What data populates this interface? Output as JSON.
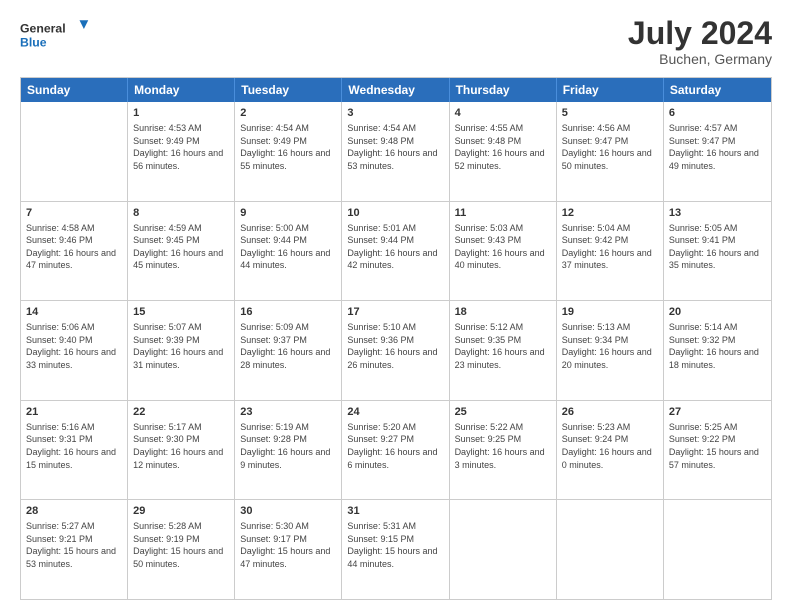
{
  "logo": {
    "line1": "General",
    "line2": "Blue"
  },
  "title": "July 2024",
  "subtitle": "Buchen, Germany",
  "header_days": [
    "Sunday",
    "Monday",
    "Tuesday",
    "Wednesday",
    "Thursday",
    "Friday",
    "Saturday"
  ],
  "rows": [
    [
      {
        "day": "",
        "sunrise": "",
        "sunset": "",
        "daylight": ""
      },
      {
        "day": "1",
        "sunrise": "Sunrise: 4:53 AM",
        "sunset": "Sunset: 9:49 PM",
        "daylight": "Daylight: 16 hours and 56 minutes."
      },
      {
        "day": "2",
        "sunrise": "Sunrise: 4:54 AM",
        "sunset": "Sunset: 9:49 PM",
        "daylight": "Daylight: 16 hours and 55 minutes."
      },
      {
        "day": "3",
        "sunrise": "Sunrise: 4:54 AM",
        "sunset": "Sunset: 9:48 PM",
        "daylight": "Daylight: 16 hours and 53 minutes."
      },
      {
        "day": "4",
        "sunrise": "Sunrise: 4:55 AM",
        "sunset": "Sunset: 9:48 PM",
        "daylight": "Daylight: 16 hours and 52 minutes."
      },
      {
        "day": "5",
        "sunrise": "Sunrise: 4:56 AM",
        "sunset": "Sunset: 9:47 PM",
        "daylight": "Daylight: 16 hours and 50 minutes."
      },
      {
        "day": "6",
        "sunrise": "Sunrise: 4:57 AM",
        "sunset": "Sunset: 9:47 PM",
        "daylight": "Daylight: 16 hours and 49 minutes."
      }
    ],
    [
      {
        "day": "7",
        "sunrise": "Sunrise: 4:58 AM",
        "sunset": "Sunset: 9:46 PM",
        "daylight": "Daylight: 16 hours and 47 minutes."
      },
      {
        "day": "8",
        "sunrise": "Sunrise: 4:59 AM",
        "sunset": "Sunset: 9:45 PM",
        "daylight": "Daylight: 16 hours and 45 minutes."
      },
      {
        "day": "9",
        "sunrise": "Sunrise: 5:00 AM",
        "sunset": "Sunset: 9:44 PM",
        "daylight": "Daylight: 16 hours and 44 minutes."
      },
      {
        "day": "10",
        "sunrise": "Sunrise: 5:01 AM",
        "sunset": "Sunset: 9:44 PM",
        "daylight": "Daylight: 16 hours and 42 minutes."
      },
      {
        "day": "11",
        "sunrise": "Sunrise: 5:03 AM",
        "sunset": "Sunset: 9:43 PM",
        "daylight": "Daylight: 16 hours and 40 minutes."
      },
      {
        "day": "12",
        "sunrise": "Sunrise: 5:04 AM",
        "sunset": "Sunset: 9:42 PM",
        "daylight": "Daylight: 16 hours and 37 minutes."
      },
      {
        "day": "13",
        "sunrise": "Sunrise: 5:05 AM",
        "sunset": "Sunset: 9:41 PM",
        "daylight": "Daylight: 16 hours and 35 minutes."
      }
    ],
    [
      {
        "day": "14",
        "sunrise": "Sunrise: 5:06 AM",
        "sunset": "Sunset: 9:40 PM",
        "daylight": "Daylight: 16 hours and 33 minutes."
      },
      {
        "day": "15",
        "sunrise": "Sunrise: 5:07 AM",
        "sunset": "Sunset: 9:39 PM",
        "daylight": "Daylight: 16 hours and 31 minutes."
      },
      {
        "day": "16",
        "sunrise": "Sunrise: 5:09 AM",
        "sunset": "Sunset: 9:37 PM",
        "daylight": "Daylight: 16 hours and 28 minutes."
      },
      {
        "day": "17",
        "sunrise": "Sunrise: 5:10 AM",
        "sunset": "Sunset: 9:36 PM",
        "daylight": "Daylight: 16 hours and 26 minutes."
      },
      {
        "day": "18",
        "sunrise": "Sunrise: 5:12 AM",
        "sunset": "Sunset: 9:35 PM",
        "daylight": "Daylight: 16 hours and 23 minutes."
      },
      {
        "day": "19",
        "sunrise": "Sunrise: 5:13 AM",
        "sunset": "Sunset: 9:34 PM",
        "daylight": "Daylight: 16 hours and 20 minutes."
      },
      {
        "day": "20",
        "sunrise": "Sunrise: 5:14 AM",
        "sunset": "Sunset: 9:32 PM",
        "daylight": "Daylight: 16 hours and 18 minutes."
      }
    ],
    [
      {
        "day": "21",
        "sunrise": "Sunrise: 5:16 AM",
        "sunset": "Sunset: 9:31 PM",
        "daylight": "Daylight: 16 hours and 15 minutes."
      },
      {
        "day": "22",
        "sunrise": "Sunrise: 5:17 AM",
        "sunset": "Sunset: 9:30 PM",
        "daylight": "Daylight: 16 hours and 12 minutes."
      },
      {
        "day": "23",
        "sunrise": "Sunrise: 5:19 AM",
        "sunset": "Sunset: 9:28 PM",
        "daylight": "Daylight: 16 hours and 9 minutes."
      },
      {
        "day": "24",
        "sunrise": "Sunrise: 5:20 AM",
        "sunset": "Sunset: 9:27 PM",
        "daylight": "Daylight: 16 hours and 6 minutes."
      },
      {
        "day": "25",
        "sunrise": "Sunrise: 5:22 AM",
        "sunset": "Sunset: 9:25 PM",
        "daylight": "Daylight: 16 hours and 3 minutes."
      },
      {
        "day": "26",
        "sunrise": "Sunrise: 5:23 AM",
        "sunset": "Sunset: 9:24 PM",
        "daylight": "Daylight: 16 hours and 0 minutes."
      },
      {
        "day": "27",
        "sunrise": "Sunrise: 5:25 AM",
        "sunset": "Sunset: 9:22 PM",
        "daylight": "Daylight: 15 hours and 57 minutes."
      }
    ],
    [
      {
        "day": "28",
        "sunrise": "Sunrise: 5:27 AM",
        "sunset": "Sunset: 9:21 PM",
        "daylight": "Daylight: 15 hours and 53 minutes."
      },
      {
        "day": "29",
        "sunrise": "Sunrise: 5:28 AM",
        "sunset": "Sunset: 9:19 PM",
        "daylight": "Daylight: 15 hours and 50 minutes."
      },
      {
        "day": "30",
        "sunrise": "Sunrise: 5:30 AM",
        "sunset": "Sunset: 9:17 PM",
        "daylight": "Daylight: 15 hours and 47 minutes."
      },
      {
        "day": "31",
        "sunrise": "Sunrise: 5:31 AM",
        "sunset": "Sunset: 9:15 PM",
        "daylight": "Daylight: 15 hours and 44 minutes."
      },
      {
        "day": "",
        "sunrise": "",
        "sunset": "",
        "daylight": ""
      },
      {
        "day": "",
        "sunrise": "",
        "sunset": "",
        "daylight": ""
      },
      {
        "day": "",
        "sunrise": "",
        "sunset": "",
        "daylight": ""
      }
    ]
  ]
}
